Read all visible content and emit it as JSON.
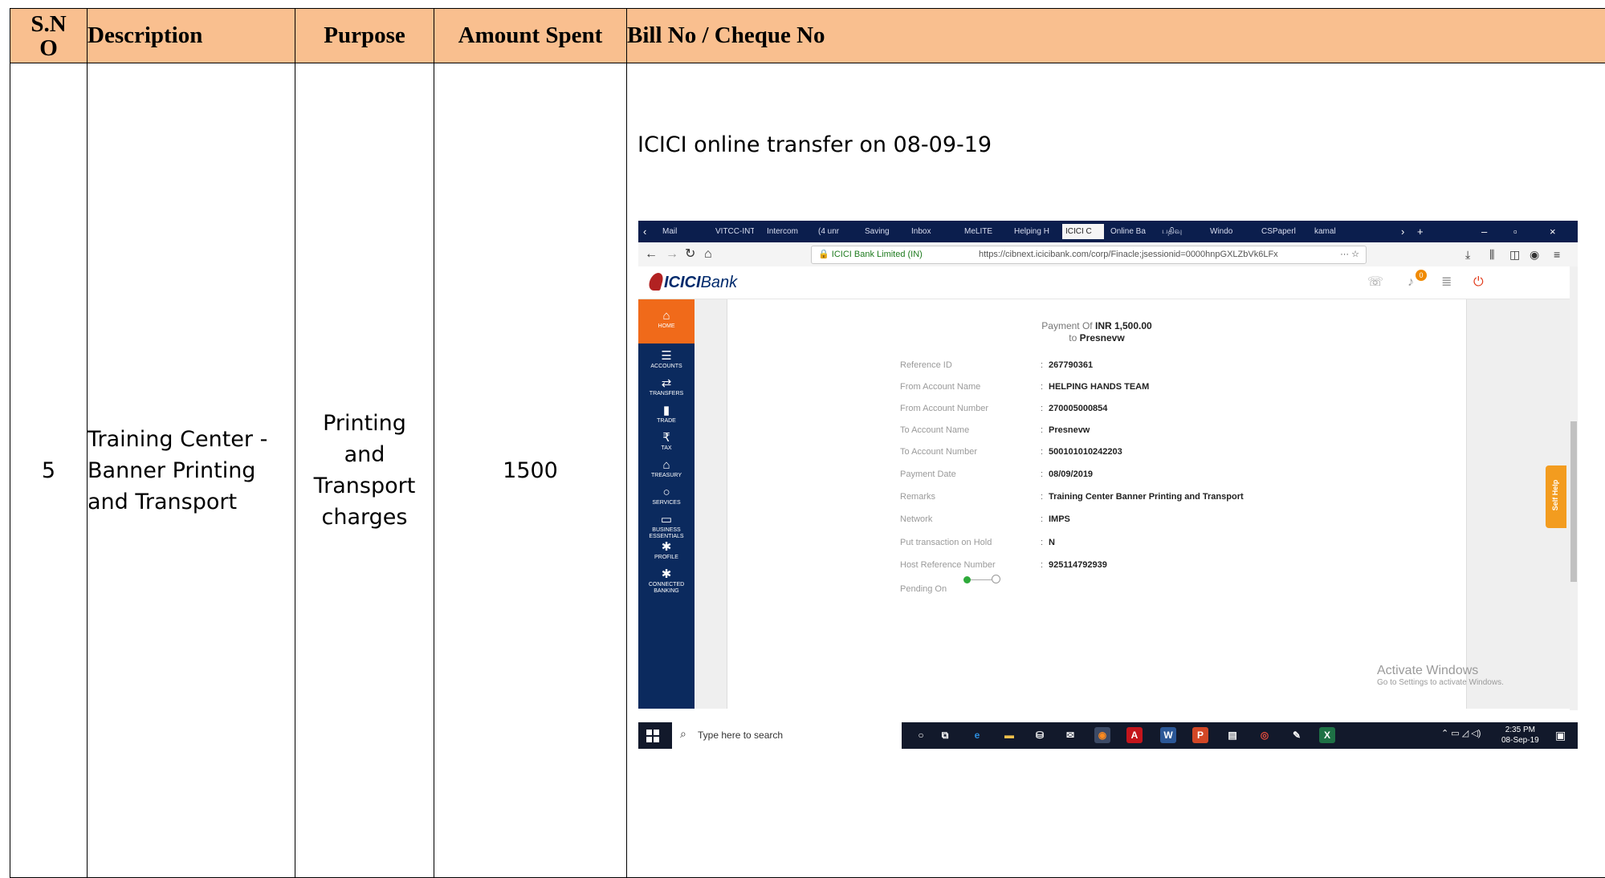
{
  "table": {
    "headers": {
      "sno_line1": "S.N",
      "sno_line2": "O",
      "description": "Description",
      "purpose": "Purpose",
      "amount": "Amount Spent",
      "bill": "Bill No / Cheque No"
    },
    "row": {
      "sno": "5",
      "description_lines": [
        "Training Center -",
        "Banner Printing",
        "and Transport"
      ],
      "purpose_lines": [
        "Printing",
        "and",
        "Transport",
        "charges"
      ],
      "amount": "1500",
      "bill_text": "ICICI online transfer on 08-09-19"
    }
  },
  "screenshot": {
    "browser": {
      "tabs": [
        "Mail",
        "VITCC-INT",
        "Intercom",
        "(4 unr",
        "Saving",
        "Inbox",
        "MeLITE",
        "Helping H",
        "ICICI C",
        "Online Ba",
        "பதிவு",
        "Windo",
        "CSPaperl",
        "kamal"
      ],
      "active_tab_index": 8,
      "secure_label": "ICICI Bank Limited (IN)",
      "url": "https://cibnext.icicibank.com/corp/Finacle;jsessionid=0000hnpGXLZbVk6LFx",
      "url_actions": "···"
    },
    "app": {
      "brand": "ICICI",
      "brand_suffix": "Bank",
      "notification_count": "0",
      "sidebar": [
        {
          "icon": "home-icon",
          "label": "HOME"
        },
        {
          "icon": "accounts-icon",
          "label": "ACCOUNTS"
        },
        {
          "icon": "transfers-icon",
          "label": "TRANSFERS"
        },
        {
          "icon": "trade-icon",
          "label": "TRADE"
        },
        {
          "icon": "tax-icon",
          "label": "TAX"
        },
        {
          "icon": "treasury-icon",
          "label": "TREASURY"
        },
        {
          "icon": "services-icon",
          "label": "SERVICES"
        },
        {
          "icon": "business-icon",
          "label": "BUSINESS ESSENTIALS"
        },
        {
          "icon": "profile-icon",
          "label": "PROFILE"
        },
        {
          "icon": "connected-banking-icon",
          "label": "CONNECTED BANKING"
        }
      ],
      "payment_of_label": "Payment Of",
      "payment_amount": "INR 1,500.00",
      "payment_to_label": "to",
      "payment_to": "Presnevw",
      "details": [
        {
          "label": "Reference ID",
          "value": "267790361"
        },
        {
          "label": "From Account Name",
          "value": "HELPING HANDS TEAM"
        },
        {
          "label": "From Account Number",
          "value": "270005000854"
        },
        {
          "label": "To Account Name",
          "value": "Presnevw"
        },
        {
          "label": "To Account Number",
          "value": "50010101024​2203"
        },
        {
          "label": "Payment Date",
          "value": "08/09/2019"
        },
        {
          "label": "Remarks",
          "value": "Training Center Banner Printing and Transport"
        },
        {
          "label": "Network",
          "value": "IMPS"
        },
        {
          "label": "Put transaction on Hold",
          "value": "N"
        },
        {
          "label": "Host Reference Number",
          "value": "925114792939"
        }
      ],
      "pending_label": "Pending On",
      "self_help": "Self Help"
    },
    "watermark": {
      "line1": "Activate Windows",
      "line2": "Go to Settings to activate Windows."
    },
    "taskbar": {
      "search_placeholder": "Type here to search",
      "time": "2:35 PM",
      "date": "08-Sep-19"
    }
  }
}
